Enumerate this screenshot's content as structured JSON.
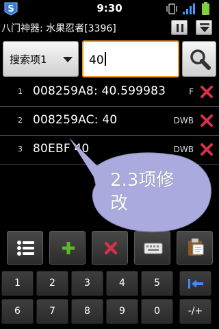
{
  "status_bar": {
    "time": "9:30",
    "icons": [
      "app-s-icon",
      "vibrate-icon",
      "signal-icon",
      "battery-icon"
    ]
  },
  "title_bar": {
    "title": "八门神器: 水果忍者[3396]",
    "buttons": [
      "pause-icon",
      "menu-down-icon"
    ]
  },
  "search": {
    "type_label": "搜索项1",
    "value": "40",
    "button_icon": "magnifier-icon"
  },
  "results": [
    {
      "index": "1",
      "text": "008259A8: 40.599983",
      "type": "F"
    },
    {
      "index": "2",
      "text": "008259AC: 40",
      "type": "DWB"
    },
    {
      "index": "3",
      "text": "80EBF  40",
      "type": "DWB"
    }
  ],
  "callout": {
    "line1": "2.3项修",
    "line2": "改"
  },
  "toolbar": {
    "icons": [
      "list-icon",
      "add-icon",
      "delete-icon",
      "keyboard-icon",
      "clipboard-icon"
    ]
  },
  "keypad": {
    "row1": [
      "1",
      "2",
      "3",
      "4",
      "5"
    ],
    "row2": [
      "6",
      "7",
      "8",
      "9",
      "0",
      "-/+"
    ],
    "backspace_icon": "backspace-icon"
  },
  "colors": {
    "accent_orange": "#f39a1e",
    "delete_red": "#d8304b",
    "add_green": "#5cb82a",
    "callout_fill": "#aaaadf"
  }
}
